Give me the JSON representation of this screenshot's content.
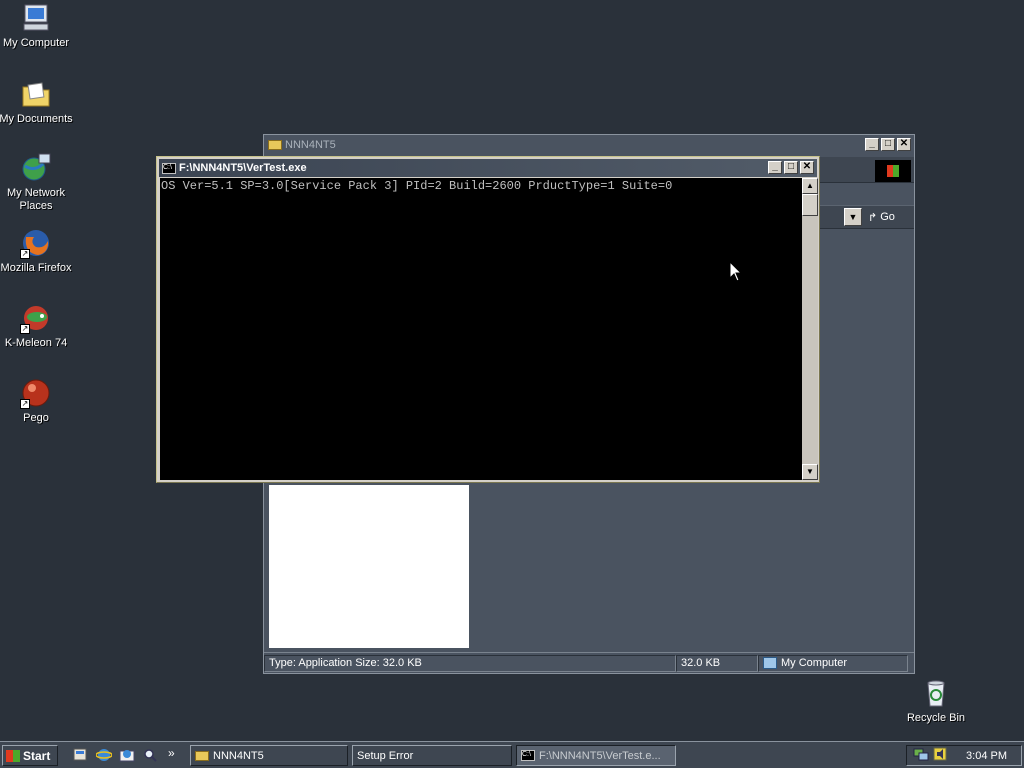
{
  "desktop": {
    "icons": [
      {
        "label": "My Computer"
      },
      {
        "label": "My Documents"
      },
      {
        "label": "My Network Places"
      },
      {
        "label": "Mozilla Firefox"
      },
      {
        "label": "K-Meleon 74"
      },
      {
        "label": "Pego"
      },
      {
        "label": "Recycle Bin"
      }
    ]
  },
  "explorer": {
    "title": "NNN4NT5",
    "go_label": "Go",
    "status": {
      "type_text": "Type: Application Size: 32.0 KB",
      "size_text": "32.0 KB",
      "zone_text": "My Computer"
    }
  },
  "console": {
    "title": "F:\\NNN4NT5\\VerTest.exe",
    "output": "OS Ver=5.1 SP=3.0[Service Pack 3] PId=2 Build=2600 PrductType=1 Suite=0"
  },
  "taskbar": {
    "start_label": "Start",
    "more_label": "»",
    "tasks": [
      {
        "label": "NNN4NT5"
      },
      {
        "label": "Setup Error"
      },
      {
        "label": "F:\\NNN4NT5\\VerTest.e..."
      }
    ],
    "clock": "3:04 PM"
  },
  "colors": {
    "desktop_bg": "#2a313a",
    "console_bg": "#000000",
    "console_text": "#c0c0c0"
  }
}
